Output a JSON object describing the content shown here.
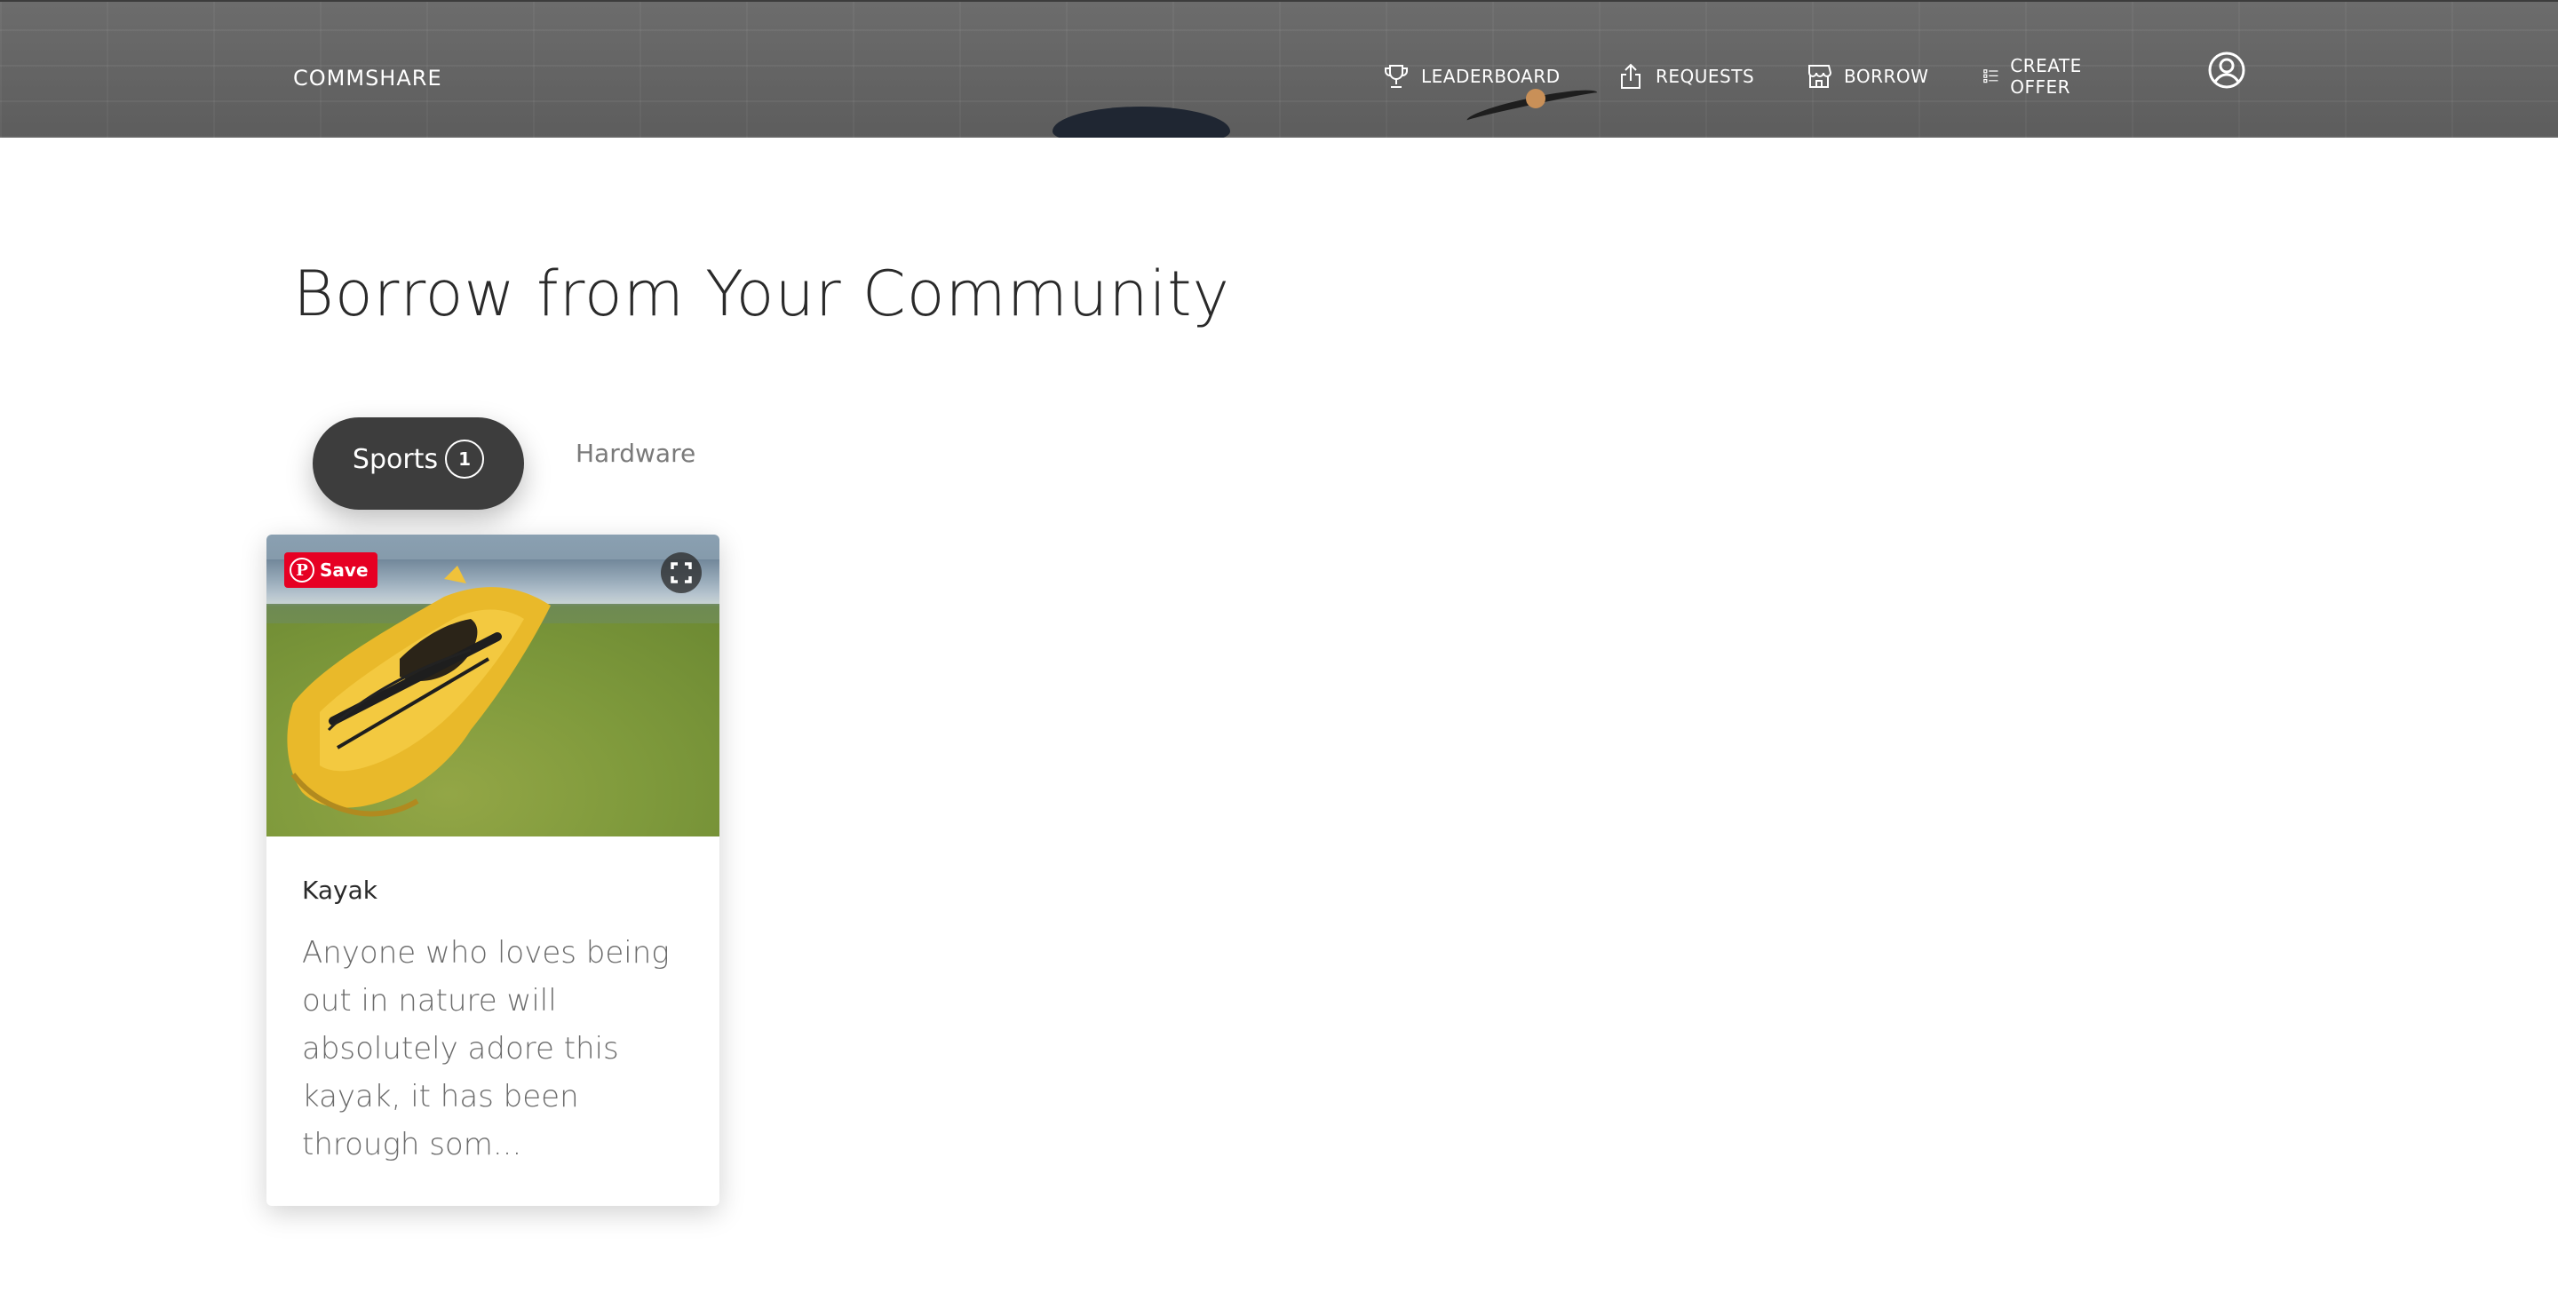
{
  "header": {
    "brand": "COMMSHARE",
    "nav": [
      {
        "label": "LEADERBOARD",
        "icon": "trophy-icon"
      },
      {
        "label": "REQUESTS",
        "icon": "upload-icon"
      },
      {
        "label": "BORROW",
        "icon": "store-icon"
      },
      {
        "label": "CREATE OFFER",
        "icon": "list-icon"
      }
    ],
    "profile_icon": "user-circle-icon"
  },
  "main": {
    "title": "Borrow from Your Community",
    "tabs": [
      {
        "label": "Sports",
        "count": "1",
        "active": true
      },
      {
        "label": "Hardware",
        "active": false
      }
    ],
    "cards": [
      {
        "save_label": "Save",
        "pin_letter": "P",
        "title": "Kayak",
        "description": "Anyone who loves being out in nature will absolutely adore this kayak, it has been through som..."
      }
    ]
  },
  "colors": {
    "accent_tab": "#3d3d3d",
    "pinterest_red": "#e60023",
    "header_bg": "#5f5f5f"
  }
}
